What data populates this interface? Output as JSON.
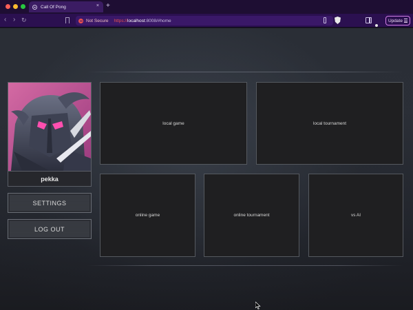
{
  "browser": {
    "tab_title": "Call Of Pong",
    "tab_close": "×",
    "new_tab": "+",
    "nav": {
      "back": "‹",
      "forward": "›",
      "reload": "↻"
    },
    "security_label": "Not Secure",
    "url": {
      "scheme": "https://",
      "host": "localhost",
      "rest": ":8008/#home"
    },
    "update_label": "Update"
  },
  "profile": {
    "username": "pekka"
  },
  "sidebar": {
    "settings_label": "SETTINGS",
    "logout_label": "LOG OUT"
  },
  "modes": {
    "local_game": "local game",
    "local_tournament": "local tournament",
    "online_game": "online game",
    "online_tournament": "online tournament",
    "vs_ai": "vs AI"
  },
  "colors": {
    "tabbar": "#1e0e33",
    "toolbar": "#2b1050",
    "accent_update": "#d27ee6",
    "card_bg": "#1f1f21",
    "not_secure": "#e8504e"
  }
}
